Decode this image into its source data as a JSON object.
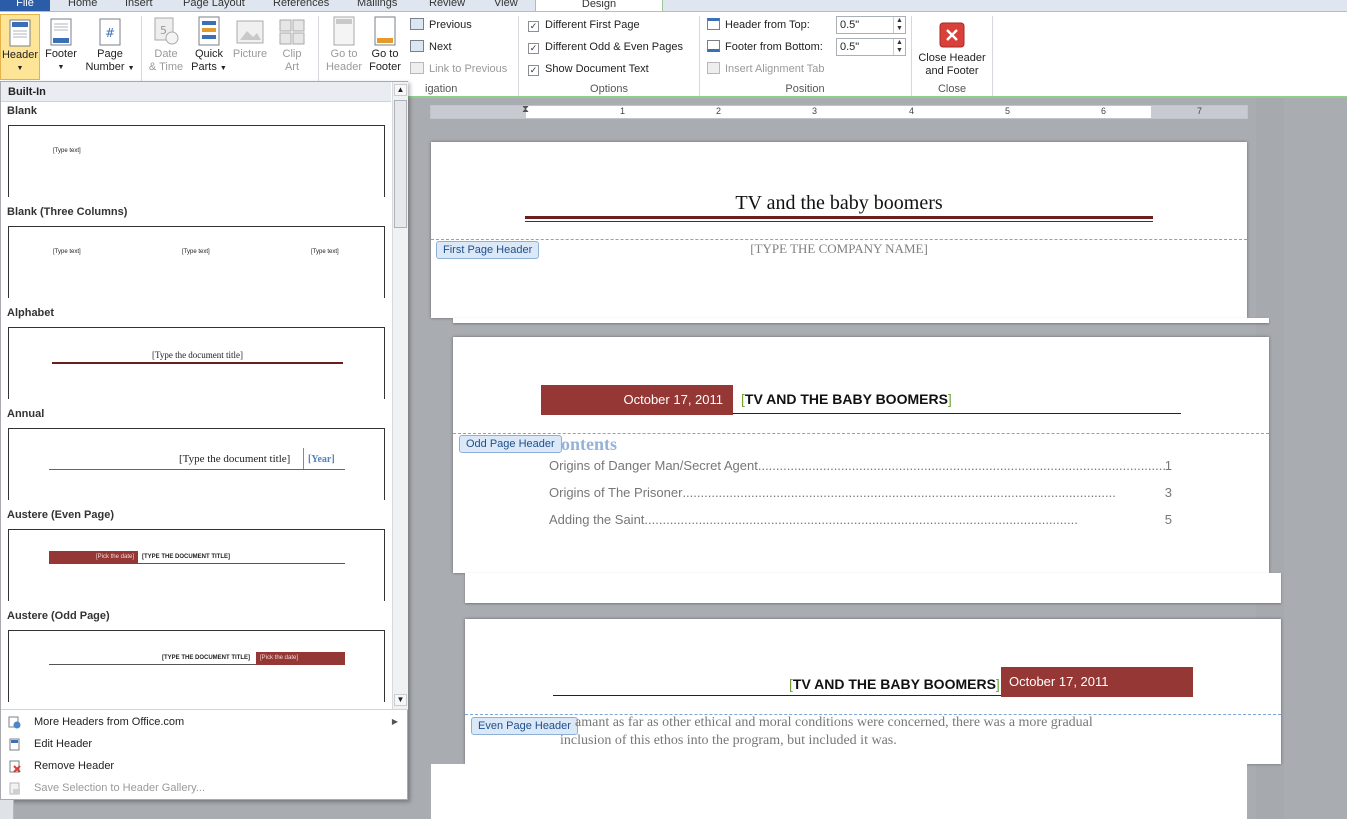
{
  "tabs": {
    "file": "File",
    "home": "Home",
    "insert": "Insert",
    "page_layout": "Page Layout",
    "references": "References",
    "mailings": "Mailings",
    "review": "Review",
    "view": "View",
    "design": "Design"
  },
  "ribbon": {
    "header": "Header",
    "footer": "Footer",
    "page_number_1": "Page",
    "page_number_2": "Number",
    "date_time_1": "Date",
    "date_time_2": "& Time",
    "quick_parts_1": "Quick",
    "quick_parts_2": "Parts",
    "picture": "Picture",
    "clip_art_1": "Clip",
    "clip_art_2": "Art",
    "go_header_1": "Go to",
    "go_header_2": "Header",
    "go_footer_1": "Go to",
    "go_footer_2": "Footer",
    "previous": "Previous",
    "next": "Next",
    "link_previous": "Link to Previous",
    "navigation_label": "igation",
    "diff_first": "Different First Page",
    "diff_odd_even": "Different Odd & Even Pages",
    "show_doc_text": "Show Document Text",
    "options_label": "Options",
    "header_from_top": "Header from Top:",
    "header_from_top_value": "0.5\"",
    "footer_from_bottom": "Footer from Bottom:",
    "footer_from_bottom_value": "0.5\"",
    "insert_alignment_tab": "Insert Alignment Tab",
    "position_label": "Position",
    "close_1": "Close Header",
    "close_2": "and Footer",
    "close_label": "Close"
  },
  "ruler": {
    "marks": [
      "1",
      "2",
      "3",
      "4",
      "5",
      "6",
      "7"
    ]
  },
  "pages": {
    "page1": {
      "title": "TV and the baby boomers",
      "tag": "First Page Header",
      "company": "[TYPE THE COMPANY NAME]"
    },
    "page2": {
      "date": "October 17, 2011",
      "title": "TV AND THE BABY BOOMERS",
      "tag": "Odd Page Header",
      "contents": "ontents",
      "toc": [
        {
          "text": "Origins of Danger Man/Secret Agent",
          "page": "1"
        },
        {
          "text": "Origins of The Prisoner",
          "page": "3"
        },
        {
          "text": "Adding the Saint",
          "page": "5"
        }
      ]
    },
    "page3": {
      "title": "TV AND THE BABY BOOMERS",
      "date": "October 17, 2011",
      "tag": "Even Page Header",
      "line1": "amant as far as other ethical and moral conditions were concerned, there was a more gradual",
      "line2": "inclusion of this ethos into the program, but included it was."
    }
  },
  "gallery": {
    "section": "Built-In",
    "items": [
      {
        "title": "Blank",
        "t1": "[Type text]"
      },
      {
        "title": "Blank (Three Columns)",
        "t1": "[Type text]",
        "t2": "[Type text]",
        "t3": "[Type text]"
      },
      {
        "title": "Alphabet",
        "t1": "[Type the document title]"
      },
      {
        "title": "Annual",
        "t1": "[Type the document title]",
        "t2": "[Year]"
      },
      {
        "title": "Austere (Even Page)",
        "t1": "[Pick the date]",
        "t2": "[TYPE THE DOCUMENT TITLE]"
      },
      {
        "title": "Austere (Odd Page)",
        "t1": "[TYPE THE DOCUMENT TITLE]",
        "t2": "[Pick the date]"
      }
    ],
    "menu": {
      "more": "More Headers from Office.com",
      "edit": "Edit Header",
      "remove": "Remove Header",
      "save": "Save Selection to Header Gallery..."
    }
  },
  "colors": {
    "accent_red": "#953735",
    "ribbon_green": "#8fcf8a",
    "file_blue": "#2a5ca8"
  }
}
